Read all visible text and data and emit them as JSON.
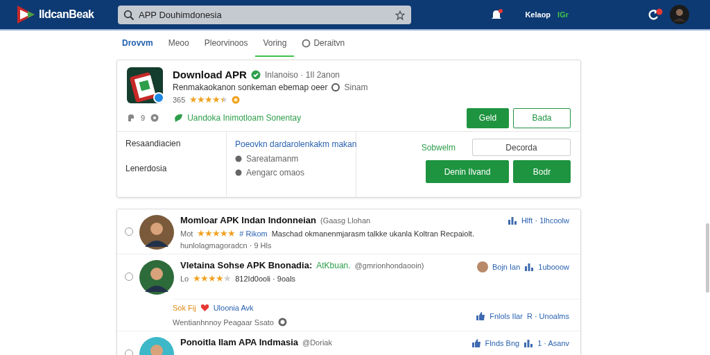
{
  "header": {
    "logo": "IldcanBeak",
    "search": {
      "value": "APP Douhimdonesia"
    },
    "bell_badge": true,
    "user_label": "Kelaop",
    "user_tag": "IGr",
    "sync_badge": true
  },
  "tabs": [
    {
      "label": "Drovvm",
      "kind": "link",
      "selected": false
    },
    {
      "label": "Meoo",
      "kind": "plain",
      "selected": false
    },
    {
      "label": "Pleorvinoos",
      "kind": "plain",
      "selected": false
    },
    {
      "label": "Voring",
      "kind": "plain",
      "selected": true
    },
    {
      "label": "Deraitvn",
      "kind": "icon",
      "selected": false
    }
  ],
  "app": {
    "title": "Download APR",
    "meta": "Inlanoiso · 1Il 2anon",
    "description": "Renmakaokanon sonkeman ebemap oeer",
    "source": "Sinam",
    "rating_count": "365",
    "stars": 4.5,
    "counter": "9",
    "promo": "Uandoka Inimotloam Sonentay",
    "buttons": [
      {
        "label": "Geld",
        "kind": "filled"
      },
      {
        "label": "Bada",
        "kind": "outline"
      }
    ],
    "details": {
      "label": "Resaandiacien",
      "value": "Lenerdosia",
      "link": "Poeovkn dardarolenkakm makan",
      "items": [
        "Sareatamanm",
        "Aengarc omaos"
      ],
      "field_label": "Sobwelm",
      "field_value": "Decorda",
      "actions": [
        {
          "label": "Denin Ilvand",
          "kind": "filled"
        },
        {
          "label": "Bodr",
          "kind": "filled"
        }
      ]
    }
  },
  "reviews": [
    {
      "name": "Momloar APK Indan Indonneian",
      "handle": "(Gaasg Llohan",
      "selected": false,
      "prefix": "Mot",
      "stars": 5,
      "topic": "# Rikom",
      "text": "Maschad okmanenmjarasm talkke ukanla Koltran Recpaiolt.",
      "footer": "hunlolagmagoradcn · 9 Hls",
      "side_stat": "Hlft · 1lhcoolw"
    },
    {
      "name": "Vletaina Sohse APK Bnonadia:",
      "tag": "AtKbuan.",
      "handle": "@gmrionhondaooin)",
      "selected": false,
      "prefix": "Lo",
      "stars": 4,
      "footer": "812Id0ooli · 9oals",
      "side_user": "Bojn Ian",
      "side_stat": "1ubooow",
      "reply": {
        "tag": "Sok Fij",
        "topic": "Uloonia Avk",
        "text": "Wentianhnnoy Peagaar Ssato",
        "side_user": "Fnlols Ilar",
        "side_stat": "R · Unoalms"
      }
    },
    {
      "name": "Ponoitla Ilam APA Indmasia",
      "handle": "@Doriak",
      "selected": false,
      "side_user": "Flnds Bng",
      "side_stat": "1 · Asanv"
    }
  ]
}
